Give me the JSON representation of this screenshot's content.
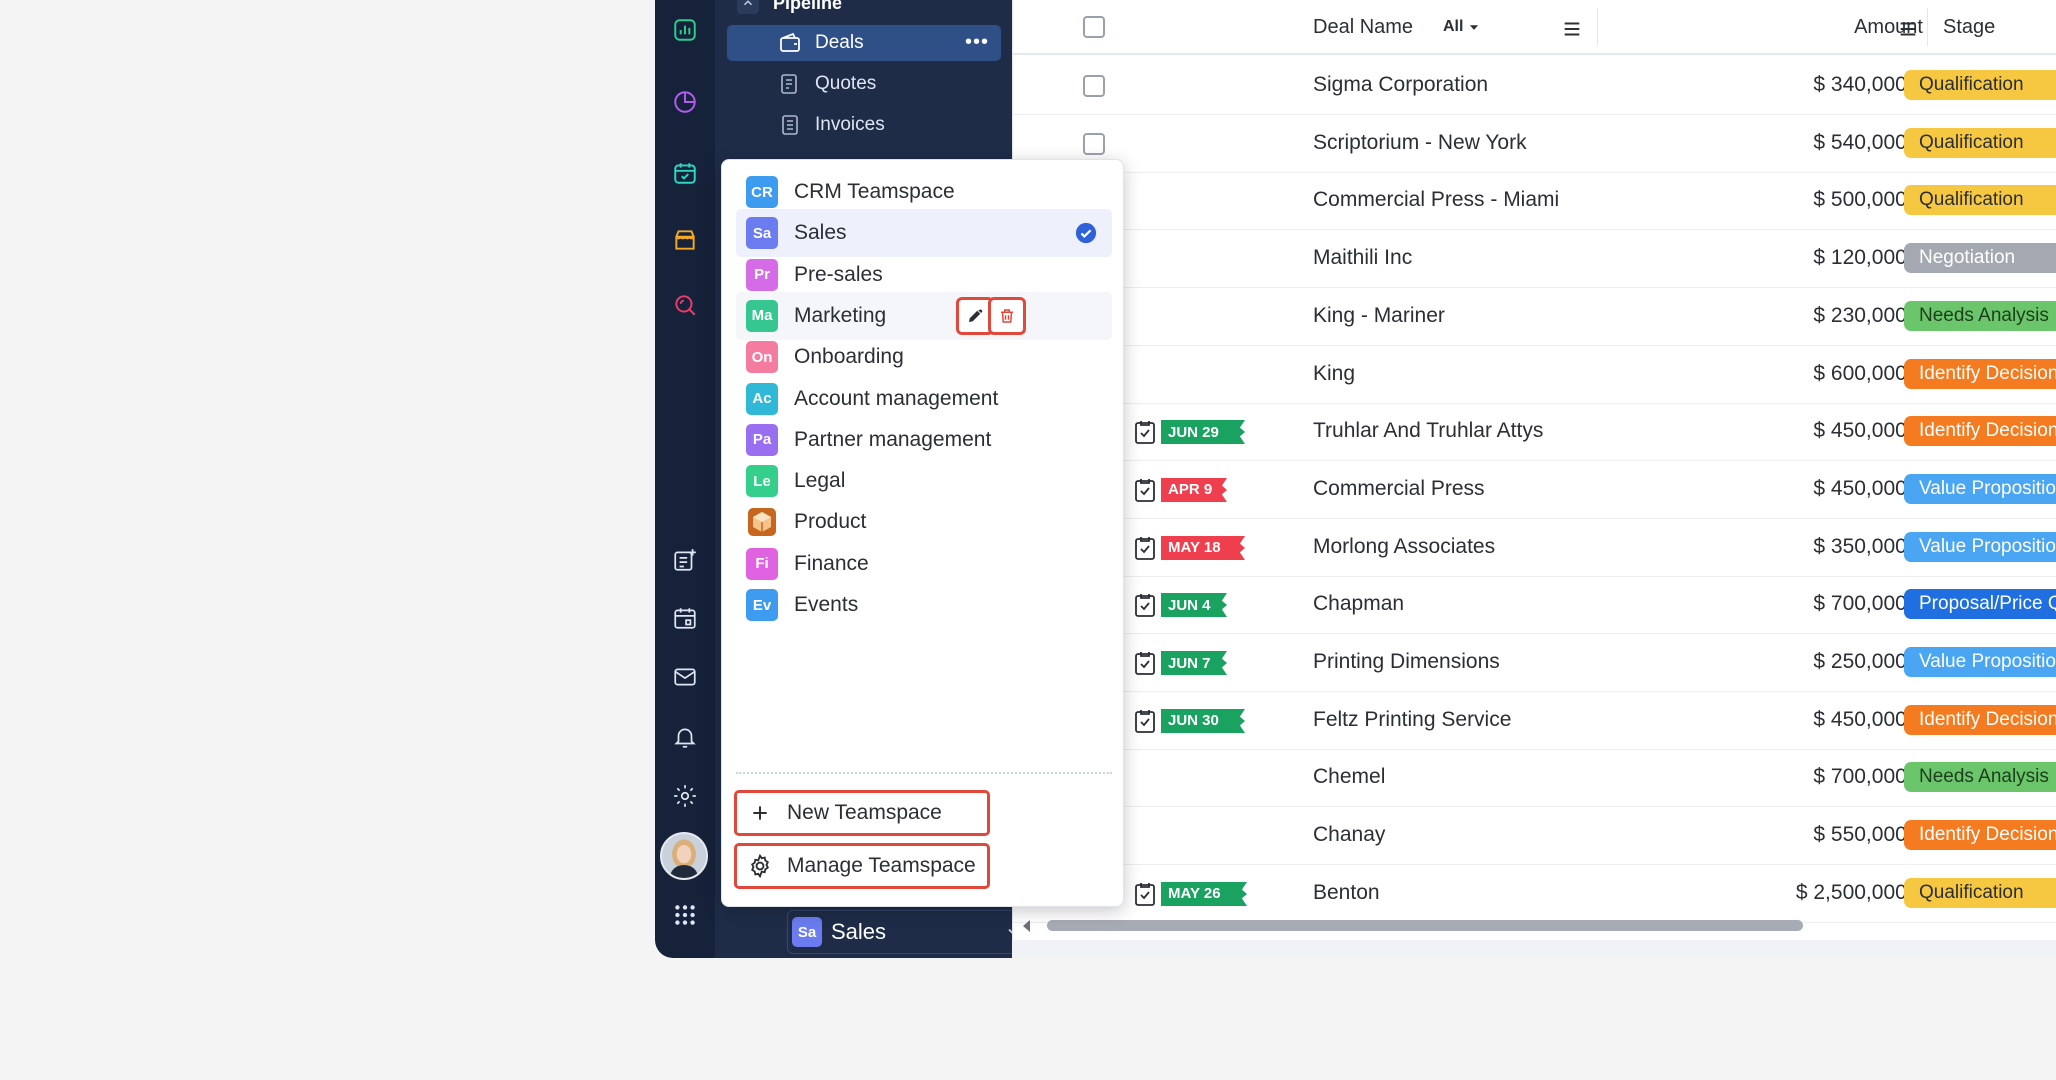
{
  "colors": {
    "rail_bg": "#16223a",
    "nav_bg": "#1e2c48",
    "nav_active": "#2f4f87",
    "highlight_border": "#e0483b",
    "check_blue": "#2f62d8"
  },
  "nav": {
    "section_title": "Pipeline",
    "items": [
      {
        "label": "Deals",
        "icon": "wallet-icon",
        "active": true,
        "more": "•••"
      },
      {
        "label": "Quotes",
        "icon": "quote-icon"
      },
      {
        "label": "Invoices",
        "icon": "invoice-icon"
      }
    ]
  },
  "switcher": {
    "badge": "Sa",
    "label": "Sales"
  },
  "table": {
    "columns": {
      "deal_name": "Deal Name",
      "filter": "All",
      "amount": "Amount",
      "stage": "Stage"
    },
    "rows": [
      {
        "name": "Sigma Corporation",
        "amount": "$ 340,000.00",
        "stage": "Qualification",
        "stage_color": "#f6c842",
        "stage_text": "#2b2e35"
      },
      {
        "name": "Scriptorium - New York",
        "amount": "$ 540,000.00",
        "stage": "Qualification",
        "stage_color": "#f6c842",
        "stage_text": "#2b2e35"
      },
      {
        "name": "Commercial Press - Miami",
        "amount": "$ 500,000.00",
        "stage": "Qualification",
        "stage_color": "#f6c842",
        "stage_text": "#2b2e35"
      },
      {
        "name": "Maithili Inc",
        "amount": "$ 120,000.00",
        "stage": "Negotiation",
        "stage_color": "#a4a8b0",
        "stage_text": "#ffffff"
      },
      {
        "name": "King - Mariner",
        "amount": "$ 230,000.00",
        "stage": "Needs Analysis",
        "stage_color": "#6bc66b",
        "stage_text": "#1d3d1d"
      },
      {
        "name": "King",
        "amount": "$ 600,000.00",
        "stage": "Identify Decision Makers",
        "stage_color": "#f47b1f",
        "stage_text": "#ffffff"
      },
      {
        "name": "Truhlar And Truhlar Attys",
        "amount": "$ 450,000.00",
        "stage": "Identify Decision Makers",
        "stage_color": "#f47b1f",
        "stage_text": "#ffffff",
        "flag": "JUN 29",
        "flag_color": "green"
      },
      {
        "name": "Commercial Press",
        "amount": "$ 450,000.00",
        "stage": "Value Proposition",
        "stage_color": "#4aa5f2",
        "stage_text": "#ffffff",
        "flag": "APR 9",
        "flag_color": "red"
      },
      {
        "name": "Morlong Associates",
        "amount": "$ 350,000.00",
        "stage": "Value Proposition",
        "stage_color": "#4aa5f2",
        "stage_text": "#ffffff",
        "flag": "MAY 18",
        "flag_color": "red"
      },
      {
        "name": "Chapman",
        "amount": "$ 700,000.00",
        "stage": "Proposal/Price Quote",
        "stage_color": "#1f6fe0",
        "stage_text": "#ffffff",
        "flag": "JUN 4",
        "flag_color": "green"
      },
      {
        "name": "Printing Dimensions",
        "amount": "$ 250,000.00",
        "stage": "Value Proposition",
        "stage_color": "#4aa5f2",
        "stage_text": "#ffffff",
        "flag": "JUN 7",
        "flag_color": "green"
      },
      {
        "name": "Feltz Printing Service",
        "amount": "$ 450,000.00",
        "stage": "Identify Decision Makers",
        "stage_color": "#f47b1f",
        "stage_text": "#ffffff",
        "flag": "JUN 30",
        "flag_color": "green"
      },
      {
        "name": "Chemel",
        "amount": "$ 700,000.00",
        "stage": "Needs Analysis",
        "stage_color": "#6bc66b",
        "stage_text": "#1d3d1d"
      },
      {
        "name": "Chanay",
        "amount": "$ 550,000.00",
        "stage": "Identify Decision Makers",
        "stage_color": "#f47b1f",
        "stage_text": "#ffffff"
      },
      {
        "name": "Benton",
        "amount": "$ 2,500,000.00",
        "stage": "Qualification",
        "stage_color": "#f6c842",
        "stage_text": "#2b2e35",
        "flag": "MAY 26",
        "flag_color": "green"
      }
    ]
  },
  "dropdown": {
    "items": [
      {
        "badge": "CR",
        "label": "CRM Teamspace",
        "color": "#3d9bf0"
      },
      {
        "badge": "Sa",
        "label": "Sales",
        "color": "#6b7cf0",
        "selected": true
      },
      {
        "badge": "Pr",
        "label": "Pre-sales",
        "color": "#d66be8"
      },
      {
        "badge": "Ma",
        "label": "Marketing",
        "color": "#36c690",
        "hover": true
      },
      {
        "badge": "On",
        "label": "Onboarding",
        "color": "#f47ca0"
      },
      {
        "badge": "Ac",
        "label": "Account management",
        "color": "#2fb9d6"
      },
      {
        "badge": "Pa",
        "label": "Partner management",
        "color": "#9a6ef0"
      },
      {
        "badge": "Le",
        "label": "Legal",
        "color": "#35cf8c"
      },
      {
        "badge": "",
        "label": "Product",
        "color": "#e87a2c",
        "icon": "box-icon"
      },
      {
        "badge": "Fi",
        "label": "Finance",
        "color": "#df63e0"
      },
      {
        "badge": "Ev",
        "label": "Events",
        "color": "#3d9bf0"
      }
    ],
    "new_label": "New Teamspace",
    "manage_label": "Manage Teamspace"
  }
}
